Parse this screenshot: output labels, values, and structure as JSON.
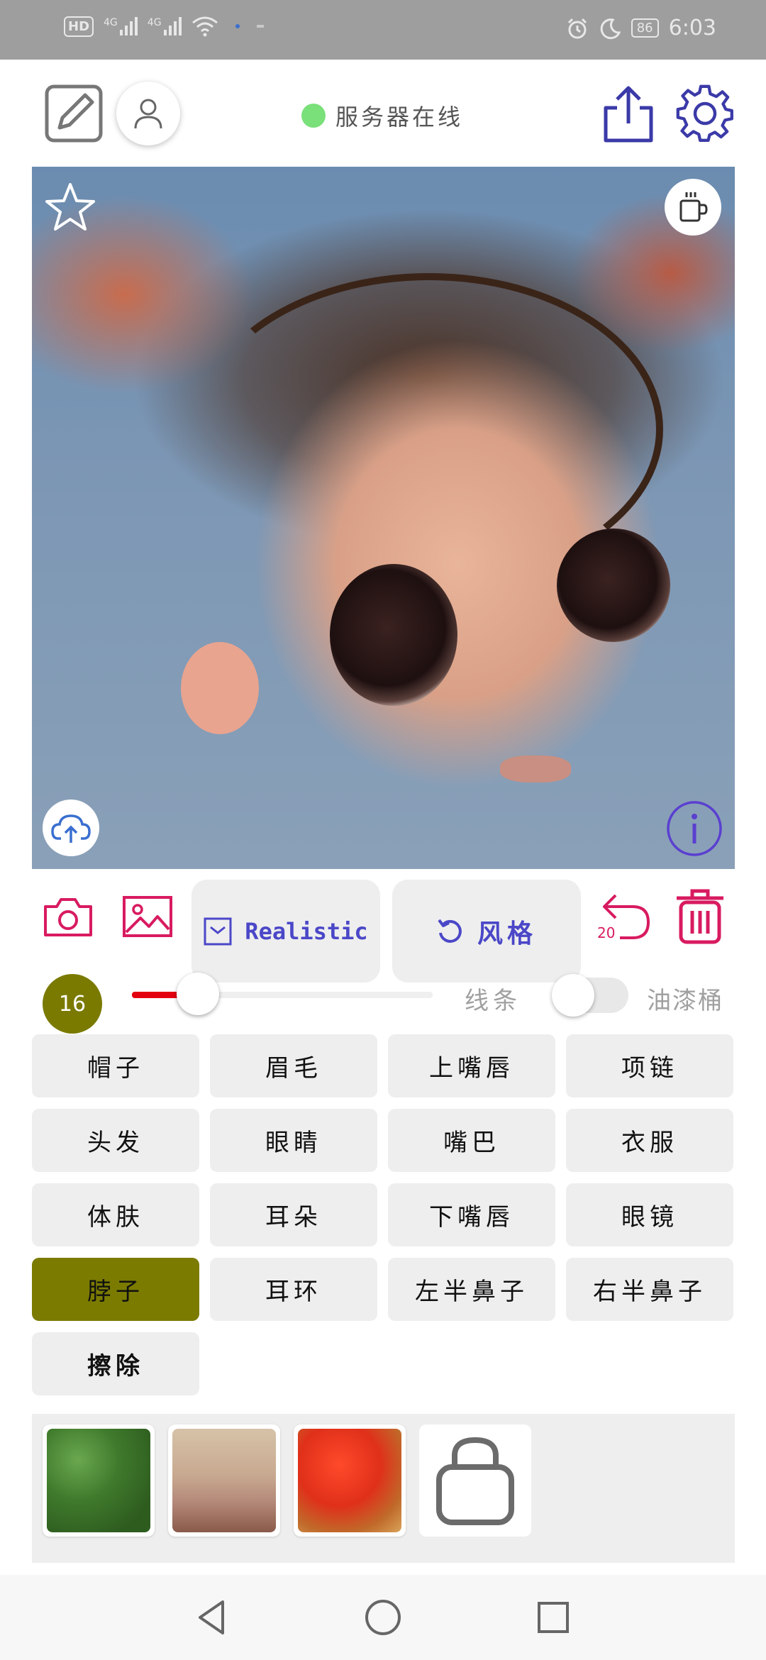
{
  "status_bar": {
    "hd_label": "HD",
    "net_label_1": "4G",
    "net_label_2": "4G",
    "battery": "86",
    "time": "6:03"
  },
  "header": {
    "server_status": "服务器在线"
  },
  "toolbar": {
    "mode_label": "Realistic",
    "style_label": "风格",
    "undo_count": "20"
  },
  "brush": {
    "size": "16",
    "size_fraction": 0.22,
    "lines_label": "线条",
    "bucket_label": "油漆桶",
    "bucket_enabled": false
  },
  "parts": [
    {
      "label": "帽子"
    },
    {
      "label": "眉毛"
    },
    {
      "label": "上嘴唇"
    },
    {
      "label": "项链"
    },
    {
      "label": "头发"
    },
    {
      "label": "眼睛"
    },
    {
      "label": "嘴巴"
    },
    {
      "label": "衣服"
    },
    {
      "label": "体肤"
    },
    {
      "label": "耳朵"
    },
    {
      "label": "下嘴唇"
    },
    {
      "label": "眼镜"
    },
    {
      "label": "脖子"
    },
    {
      "label": "耳环"
    },
    {
      "label": "左半鼻子"
    },
    {
      "label": "右半鼻子"
    },
    {
      "label": "擦除"
    }
  ],
  "selected_part": "脖子",
  "textures": [
    {
      "name": "green-foliage"
    },
    {
      "name": "pink-flowers"
    },
    {
      "name": "red-flowers"
    }
  ],
  "colors": {
    "accent_pink": "#d81b60",
    "accent_purple": "#4b47c8",
    "selected_olive": "#7b7b00",
    "slider_red": "#e3000f",
    "status_green": "#7ae07a"
  }
}
